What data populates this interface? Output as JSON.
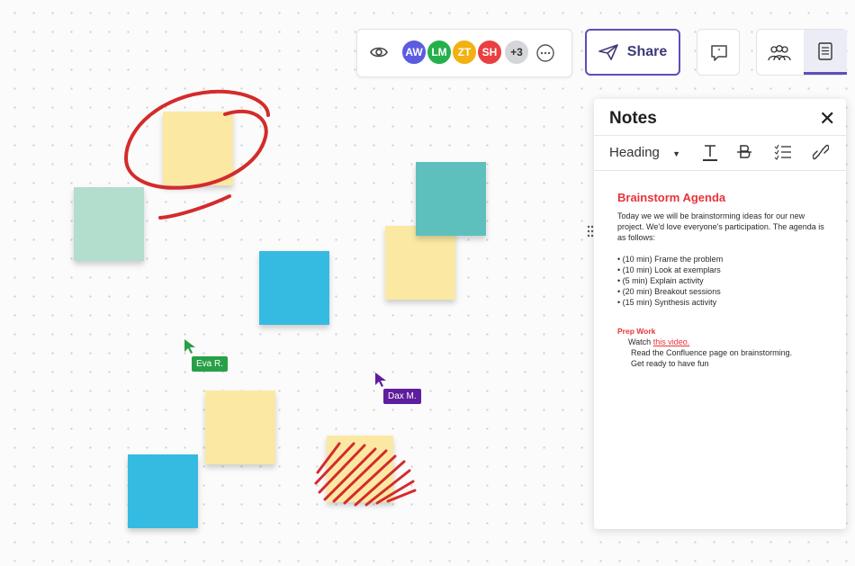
{
  "toolbar": {
    "avatars": [
      {
        "initials": "AW",
        "color": "#5b5ce0"
      },
      {
        "initials": "LM",
        "color": "#26b04b"
      },
      {
        "initials": "ZT",
        "color": "#f2b110"
      },
      {
        "initials": "SH",
        "color": "#ea3f41"
      }
    ],
    "overflow_count": "+3",
    "share_label": "Share"
  },
  "notes": {
    "title": "Notes",
    "heading_select": "Heading",
    "title_text": "Brainstorm Agenda",
    "intro": "Today we we will be brainstorming ideas for our new project. We'd love everyone's participation. The agenda is as follows:",
    "agenda": [
      "• (10 min) Frame the problem",
      "• (10 min) Look at exemplars",
      "• (5 min) Explain activity",
      "• (20 min) Breakout sessions",
      "• (15 min) Synthesis activity"
    ],
    "prep_title": "Prep Work",
    "prep_watch": "Watch ",
    "prep_link": "this video.",
    "prep_items": [
      "Read the Confluence page on brainstorming.",
      "Get ready to have fun"
    ]
  },
  "cursors": {
    "eva": {
      "label": "Eva R.",
      "color": "#27a047"
    },
    "dax": {
      "label": "Dax M.",
      "color": "#5f1e9e"
    }
  },
  "colors": {
    "sticky_yellow": "#fbe9a3",
    "sticky_mint": "#b3ddcc",
    "sticky_teal": "#5ec0bd",
    "sticky_blue": "#35bbe1",
    "ink_red": "#d42b2b",
    "accent_purple": "#5b50b6"
  }
}
